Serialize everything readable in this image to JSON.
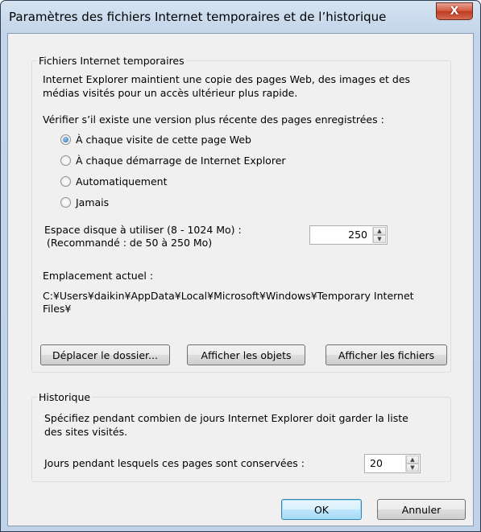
{
  "window": {
    "title": "Paramètres des fichiers Internet temporaires et de l’historique",
    "close_glyph": "X"
  },
  "temp_files": {
    "legend": "Fichiers Internet temporaires",
    "description_line1": "Internet Explorer maintient une copie des pages Web, des images et des",
    "description_line2": "médias visités pour un accès ultérieur plus rapide.",
    "check_label": "Vérifier s’il existe une version plus récente des pages enregistrées :",
    "options": [
      {
        "label": "À chaque visite de cette page Web",
        "selected": true
      },
      {
        "label": "À chaque démarrage de Internet Explorer",
        "selected": false
      },
      {
        "label": "Automatiquement",
        "selected": false
      },
      {
        "label": "Jamais",
        "selected": false
      }
    ],
    "disk_label_line1": "Espace disque à utiliser (8 - 1024 Mo) :",
    "disk_label_line2": "(Recommandé : de 50 à 250 Mo)",
    "disk_value": "250",
    "location_label": "Emplacement actuel :",
    "location_line1": "C:¥Users¥daikin¥AppData¥Local¥Microsoft¥Windows¥Temporary Internet",
    "location_line2": "Files¥",
    "move_folder_button": "Déplacer le dossier...",
    "view_objects_button": "Afficher les objets",
    "view_files_button": "Afficher les fichiers"
  },
  "history": {
    "legend": "Historique",
    "description_line1": "Spécifiez pendant combien de jours Internet Explorer doit garder la liste",
    "description_line2": "des sites visités.",
    "days_label": "Jours pendant lesquels ces pages sont conservées :",
    "days_value": "20"
  },
  "buttons": {
    "ok": "OK",
    "cancel": "Annuler"
  }
}
